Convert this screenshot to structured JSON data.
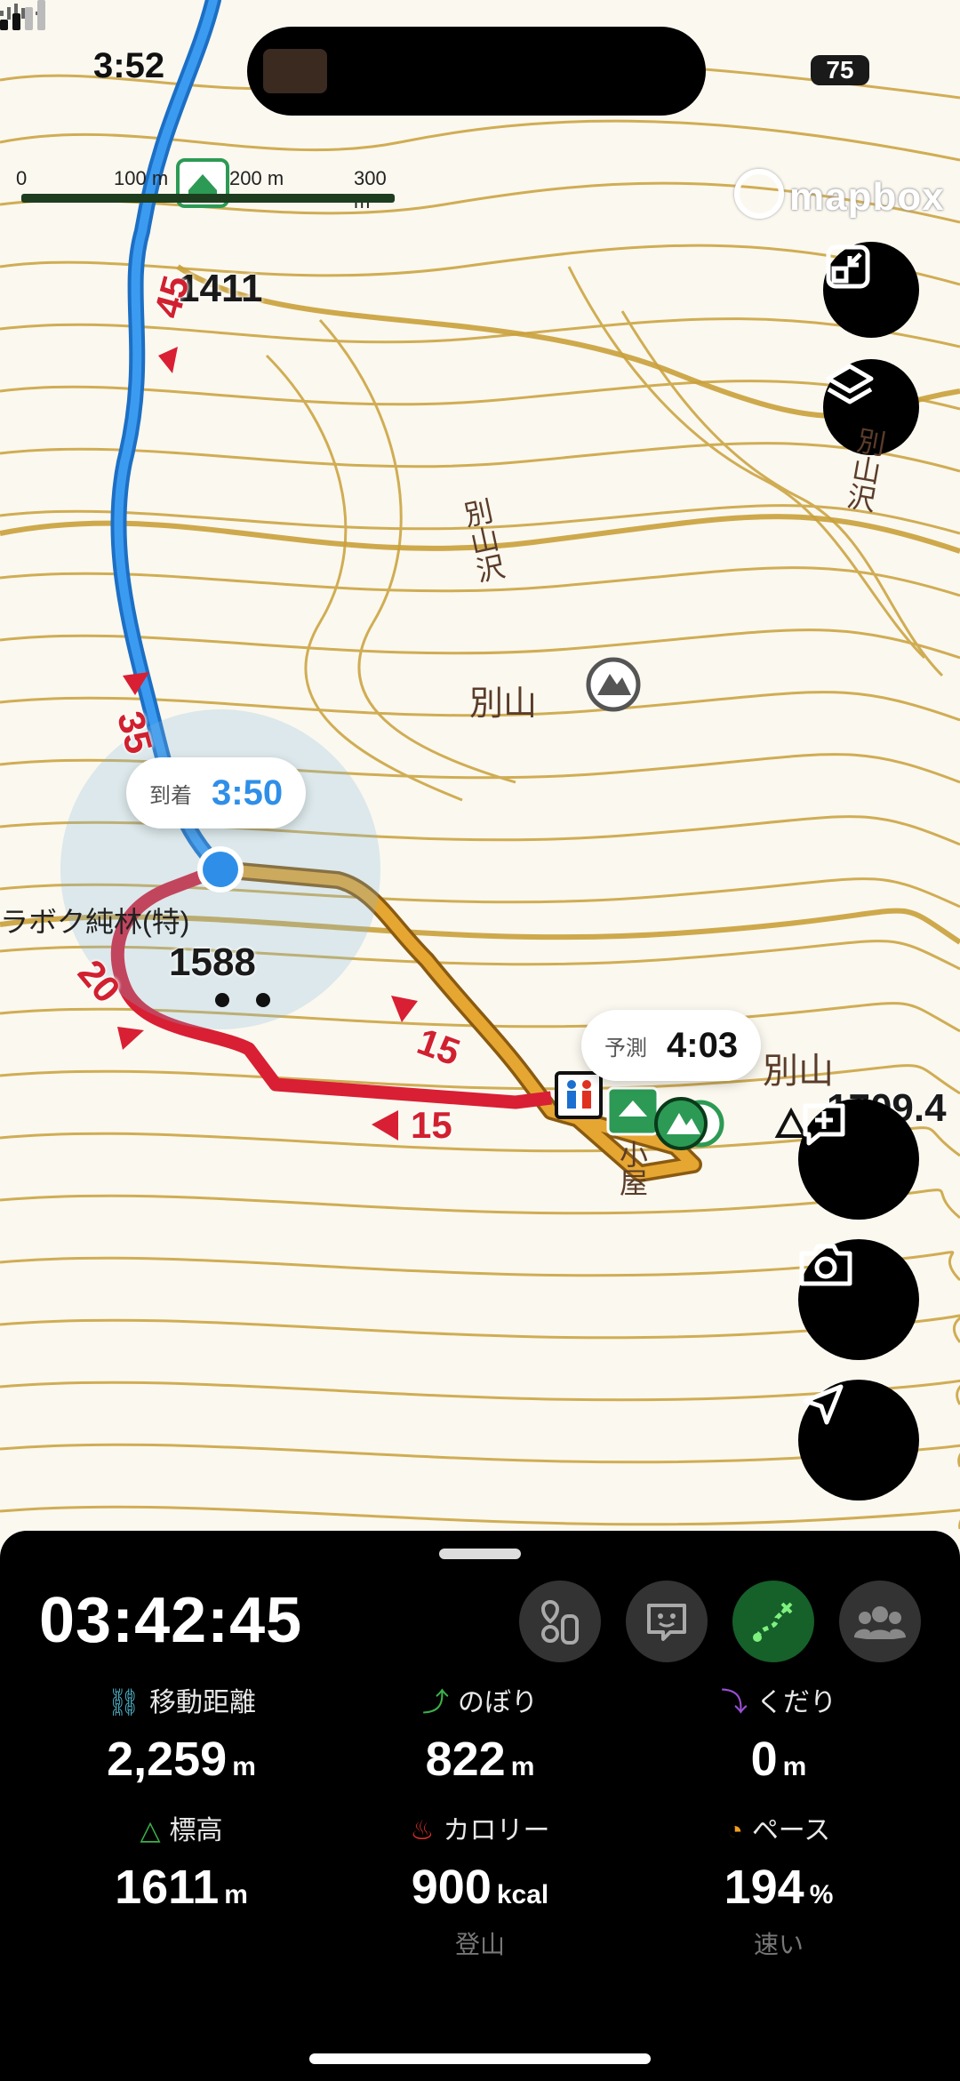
{
  "status": {
    "time": "3:52",
    "battery": "75"
  },
  "scale": {
    "labels": [
      "0",
      "100 m",
      "200 m",
      "300 m"
    ]
  },
  "attribution": "mapbox",
  "map": {
    "place_labels": [
      {
        "text": "別山",
        "kind": "peak-name"
      },
      {
        "text": "別山沢",
        "kind": "valley"
      },
      {
        "text": "別山沢",
        "kind": "valley"
      },
      {
        "text": "ラボク純林(特)",
        "kind": "note"
      },
      {
        "text": "小屋",
        "kind": "hut"
      },
      {
        "text": "別山",
        "kind": "peak-name"
      }
    ],
    "elevations": [
      "1411",
      "1588",
      "1709.4"
    ],
    "trail_times": [
      "45",
      "35",
      "20",
      "15",
      "15"
    ]
  },
  "arrival": {
    "label": "到着",
    "time": "3:50"
  },
  "forecast": {
    "label": "予測",
    "time": "4:03"
  },
  "panel": {
    "elapsed": "03:42:45",
    "stats": [
      {
        "label": "移動距離",
        "value": "2,259",
        "unit": "m",
        "icon": "distance-icon",
        "color": "#4fb3c9"
      },
      {
        "label": "のぼり",
        "value": "822",
        "unit": "m",
        "icon": "ascent-icon",
        "color": "#3bb04a"
      },
      {
        "label": "くだり",
        "value": "0",
        "unit": "m",
        "icon": "descent-icon",
        "color": "#9b4fd6"
      },
      {
        "label": "標高",
        "value": "1611",
        "unit": "m",
        "icon": "altitude-icon",
        "color": "#3bb04a"
      },
      {
        "label": "カロリー",
        "value": "900",
        "unit": "kcal",
        "icon": "calorie-icon",
        "color": "#e2332c"
      },
      {
        "label": "ペース",
        "value": "194",
        "unit": "%",
        "icon": "pace-icon",
        "color": "#f0a020"
      }
    ],
    "subtitles": {
      "calorie": "登山",
      "pace": "速い"
    }
  },
  "colors": {
    "contour": "#c9a03a",
    "track": "#d91f33",
    "planned": "#e6a632",
    "past": "#2e8fe0",
    "accent": "#16602a"
  }
}
